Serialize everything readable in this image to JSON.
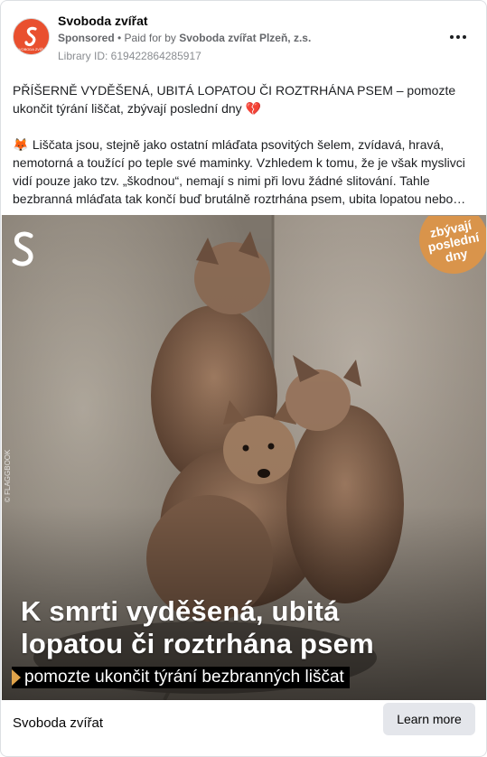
{
  "header": {
    "page_name": "Svoboda zvířat",
    "sponsored_label": "Sponsored",
    "paid_for_prefix": " • Paid for by ",
    "payer": "Svoboda zvířat Plzeň, z.s.",
    "library_id": "Library ID: 619422864285917",
    "avatar_text": "SVOBODA ZVÍŘAT"
  },
  "post": {
    "headline": "PŘÍŠERNĚ VYDĚŠENÁ, UBITÁ LOPATOU ČI ROZTRHÁNA PSEM – pomozte ukončit týrání liščat, zbývají poslední dny",
    "headline_line1": "PŘÍŠERNĚ VYDĚŠENÁ, UBITÁ LOPATOU ČI ROZTRHÁNA PSEM – pomozte",
    "headline_line2": "ukončit týrání liščat, zbývají poslední dny",
    "heart_emoji": "💔",
    "fox_emoji": "🦊",
    "body_line1": "Liščata jsou, stejně jako ostatní mláďata psovitých šelem, zvídavá, hravá,",
    "body_line2": "nemotorná a toužící po teple své maminky. Vzhledem k tomu, že je však myslivci",
    "body_line3": "vidí pouze jako tzv. „škodnou“, nemají s nimi při lovu žádné slitování. Tahle",
    "body_line4": "bezbranná mláďata tak končí buď brutálně roztrhána psem, ubita lopatou nebo…"
  },
  "image": {
    "description_icon": "fox-cubs-photo",
    "overlay_title_line1": "K smrti vyděšená, ubitá",
    "overlay_title_line2": "lopatou či roztrhána psem",
    "overlay_subtitle": "pomozte ukončit týrání bezbranných liščat",
    "badge_line1": "zbývají",
    "badge_line2": "poslední",
    "badge_line3": "dny",
    "credit": "© FLAGGBOOK"
  },
  "footer": {
    "page_name": "Svoboda zvířat",
    "cta_label": "Learn more"
  },
  "colors": {
    "brand": "#e9502f",
    "badge": "#d9944b",
    "cta_bg": "#e4e6eb",
    "subtitle_arrow": "#e0a34a"
  }
}
